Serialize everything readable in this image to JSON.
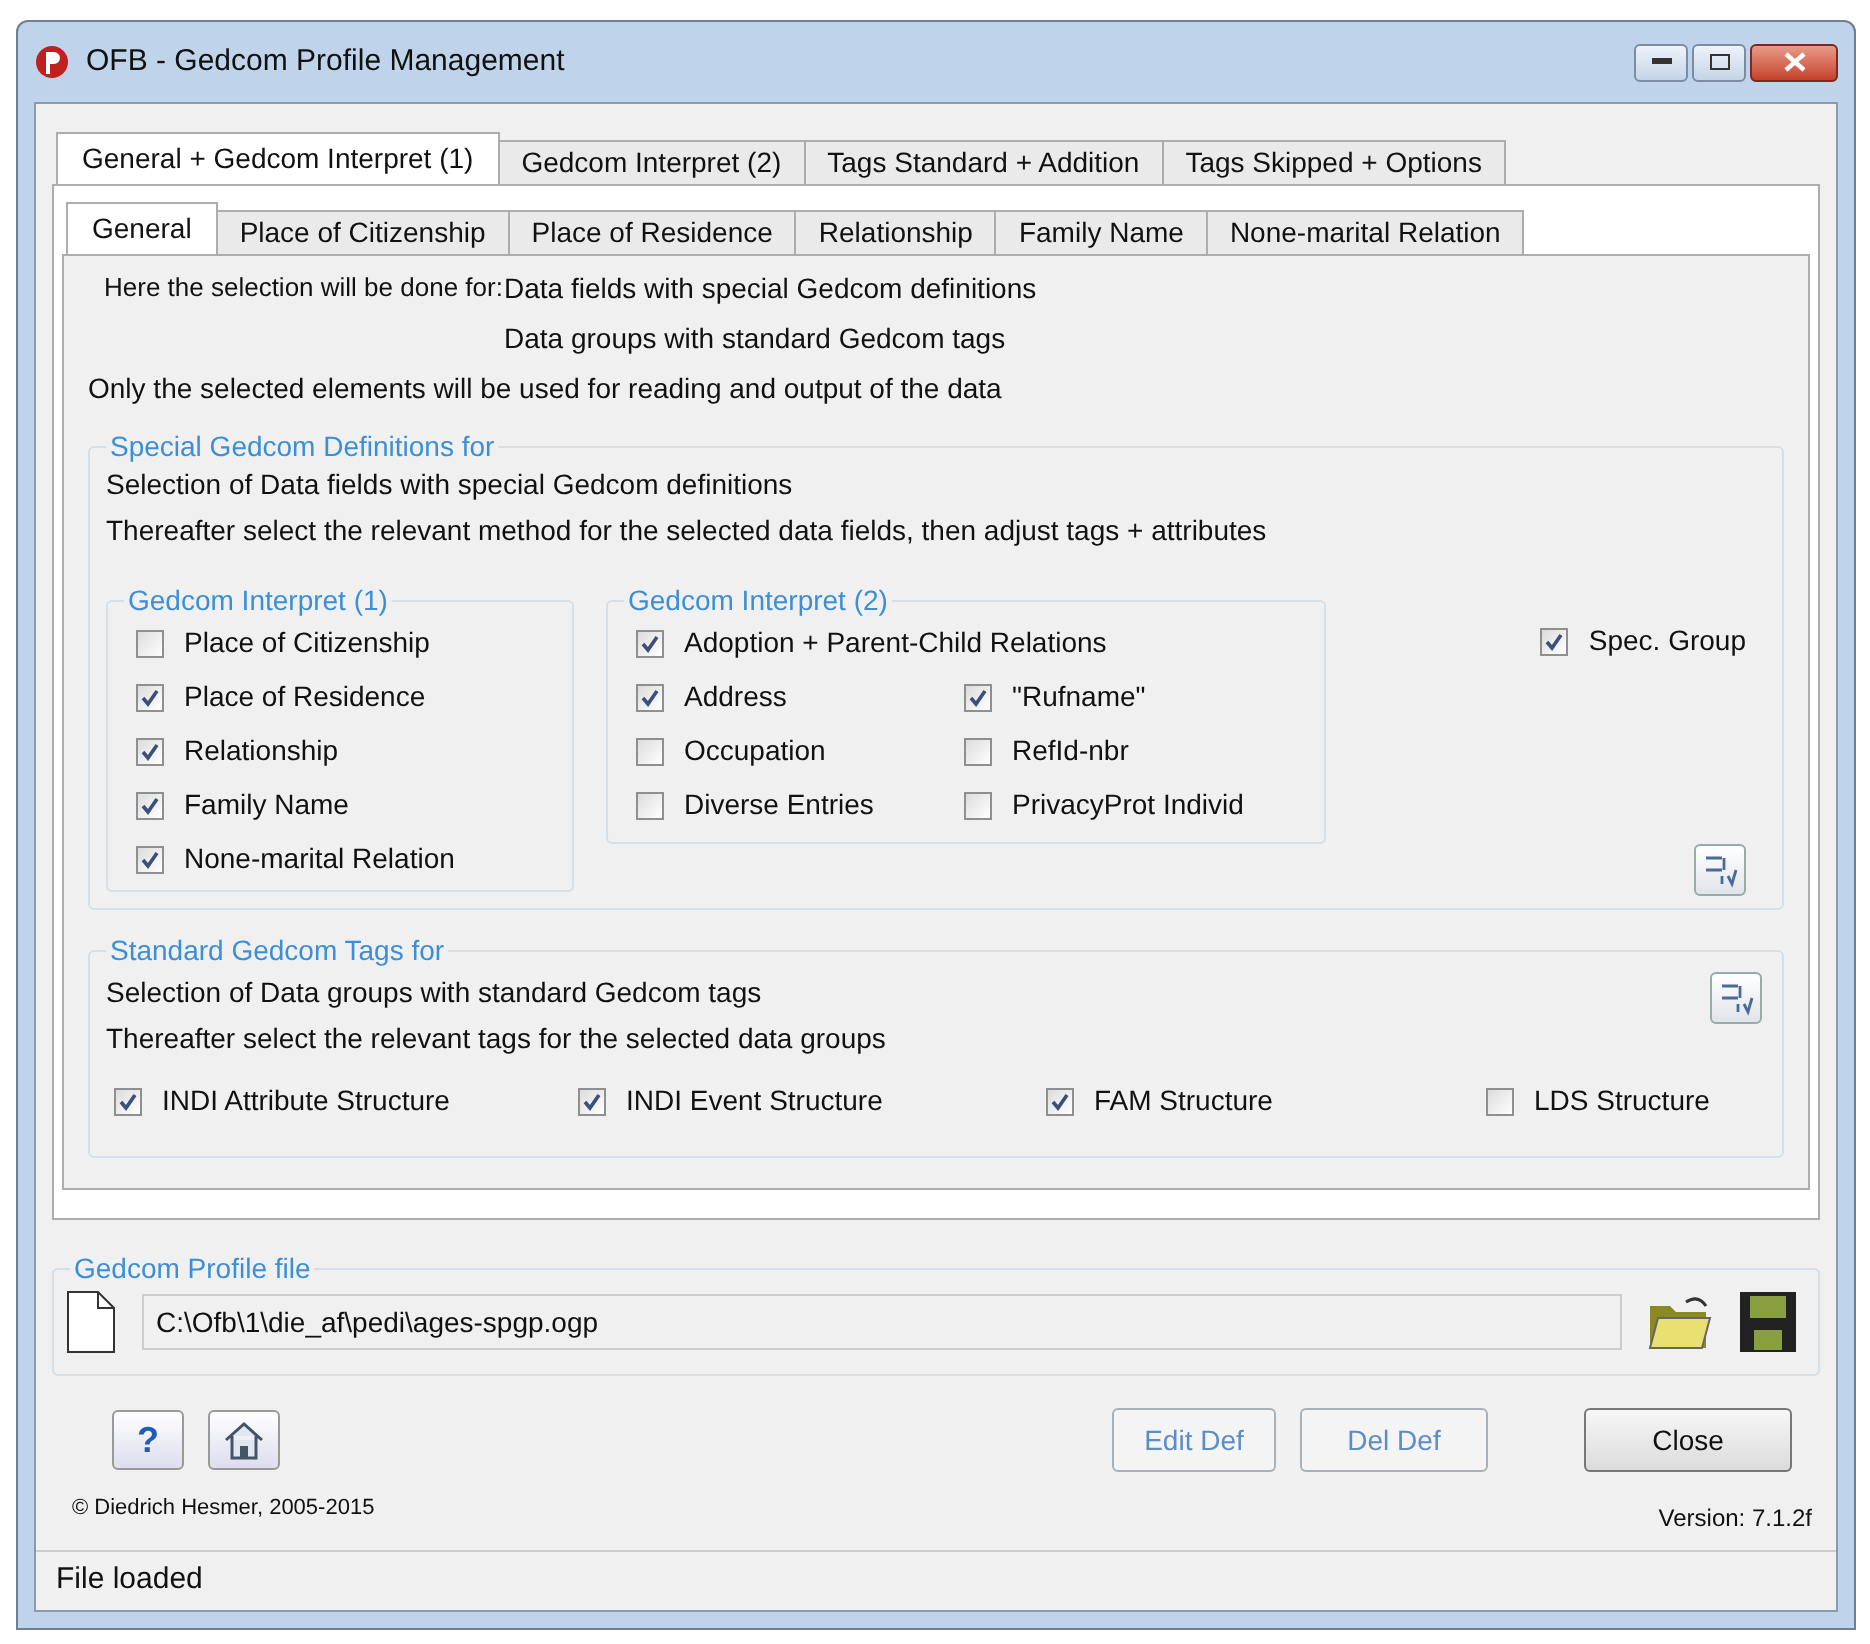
{
  "window": {
    "title": "OFB - Gedcom Profile Management"
  },
  "outer_tabs": [
    {
      "label": "General + Gedcom Interpret (1)",
      "selected": true
    },
    {
      "label": "Gedcom Interpret (2)",
      "selected": false
    },
    {
      "label": "Tags Standard + Addition",
      "selected": false
    },
    {
      "label": "Tags Skipped + Options",
      "selected": false
    }
  ],
  "inner_tabs": [
    {
      "label": "General",
      "selected": true
    },
    {
      "label": "Place of Citizenship",
      "selected": false
    },
    {
      "label": "Place of Residence",
      "selected": false
    },
    {
      "label": "Relationship",
      "selected": false
    },
    {
      "label": "Family Name",
      "selected": false
    },
    {
      "label": "None-marital Relation",
      "selected": false
    }
  ],
  "intro": {
    "label": "Here the selection will be done for:",
    "items": [
      "Data fields with special Gedcom definitions",
      "Data groups with standard Gedcom tags"
    ],
    "note": "Only the selected elements will be used for reading and output of the data"
  },
  "special": {
    "title": "Special Gedcom Definitions for",
    "lines": [
      "Selection of Data fields with special Gedcom definitions",
      "Thereafter select the relevant method for the selected data fields, then adjust tags + attributes"
    ],
    "group1": {
      "title": "Gedcom Interpret (1)",
      "items": [
        {
          "label": "Place of Citizenship",
          "checked": false
        },
        {
          "label": "Place of Residence",
          "checked": true
        },
        {
          "label": "Relationship",
          "checked": true
        },
        {
          "label": "Family Name",
          "checked": true
        },
        {
          "label": "None-marital Relation",
          "checked": true
        }
      ]
    },
    "group2": {
      "title": "Gedcom Interpret (2)",
      "wide": {
        "label": "Adoption + Parent-Child Relations",
        "checked": true
      },
      "left": [
        {
          "label": "Address",
          "checked": true
        },
        {
          "label": "Occupation",
          "checked": false
        },
        {
          "label": "Diverse Entries",
          "checked": false
        }
      ],
      "right": [
        {
          "label": "\"Rufname\"",
          "checked": true
        },
        {
          "label": "RefId-nbr",
          "checked": false
        },
        {
          "label": "PrivacyProt Individ",
          "checked": false
        }
      ]
    },
    "spec_group": {
      "label": "Spec. Group",
      "checked": true
    }
  },
  "standard": {
    "title": "Standard Gedcom Tags for",
    "lines": [
      "Selection of Data groups with standard Gedcom tags",
      "Thereafter select the relevant tags for the selected data groups"
    ],
    "items": [
      {
        "label": "INDI Attribute Structure",
        "checked": true
      },
      {
        "label": "INDI Event Structure",
        "checked": true
      },
      {
        "label": "FAM Structure",
        "checked": true
      },
      {
        "label": "LDS Structure",
        "checked": false
      }
    ]
  },
  "profile": {
    "title": "Gedcom Profile file",
    "path": "C:\\Ofb\\1\\die_af\\pedi\\ages-spgp.ogp"
  },
  "buttons": [
    {
      "label": "Edit Def",
      "disabled": true
    },
    {
      "label": "Del Def",
      "disabled": true
    },
    {
      "label": "Close",
      "disabled": false
    }
  ],
  "help_button": {
    "label": "?"
  },
  "copyright": "© Diedrich Hesmer,  2005-2015",
  "version": "Version: 7.1.2f",
  "status_bar": "File loaded"
}
